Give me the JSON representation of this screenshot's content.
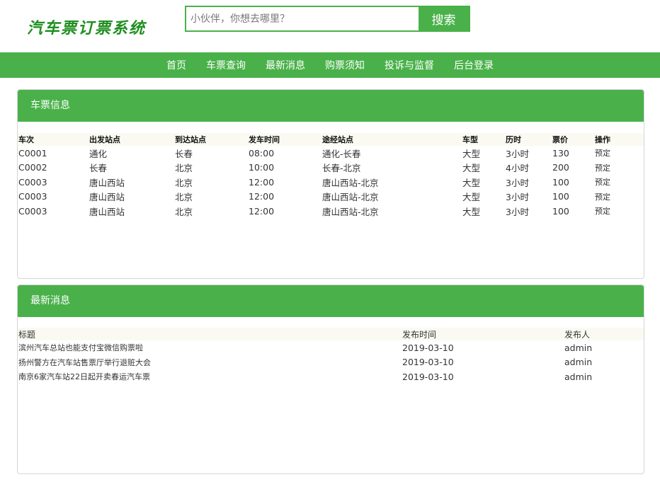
{
  "header": {
    "logo": "汽车票订票系统",
    "search_placeholder": "小伙伴，你想去哪里？",
    "search_button": "搜索"
  },
  "nav": [
    "首页",
    "车票查询",
    "最新消息",
    "购票须知",
    "投诉与监督",
    "后台登录"
  ],
  "tickets": {
    "title": "车票信息",
    "columns": [
      "车次",
      "出发站点",
      "到达站点",
      "发车时间",
      "途经站点",
      "车型",
      "历时",
      "票价",
      "操作"
    ],
    "rows": [
      [
        "C0001",
        "通化",
        "长春",
        "08:00",
        "通化-长春",
        "大型",
        "3小时",
        "130",
        "预定"
      ],
      [
        "C0002",
        "长春",
        "北京",
        "10:00",
        "长春-北京",
        "大型",
        "4小时",
        "200",
        "预定"
      ],
      [
        "C0003",
        "唐山西站",
        "北京",
        "12:00",
        "唐山西站-北京",
        "大型",
        "3小时",
        "100",
        "预定"
      ],
      [
        "C0003",
        "唐山西站",
        "北京",
        "12:00",
        "唐山西站-北京",
        "大型",
        "3小时",
        "100",
        "预定"
      ],
      [
        "C0003",
        "唐山西站",
        "北京",
        "12:00",
        "唐山西站-北京",
        "大型",
        "3小时",
        "100",
        "预定"
      ]
    ]
  },
  "news": {
    "title": "最新消息",
    "columns": [
      "标题",
      "发布时间",
      "发布人"
    ],
    "rows": [
      [
        "滨州汽车总站也能支付宝微信购票啦",
        "2019-03-10",
        "admin"
      ],
      [
        "扬州警方在汽车站售票厅举行退赃大会",
        "2019-03-10",
        "admin"
      ],
      [
        "南京6家汽车站22日起开卖春运汽车票",
        "2019-03-10",
        "admin"
      ]
    ]
  },
  "colors": {
    "accent": "#4ab14a",
    "logo": "#1f8f1f"
  }
}
